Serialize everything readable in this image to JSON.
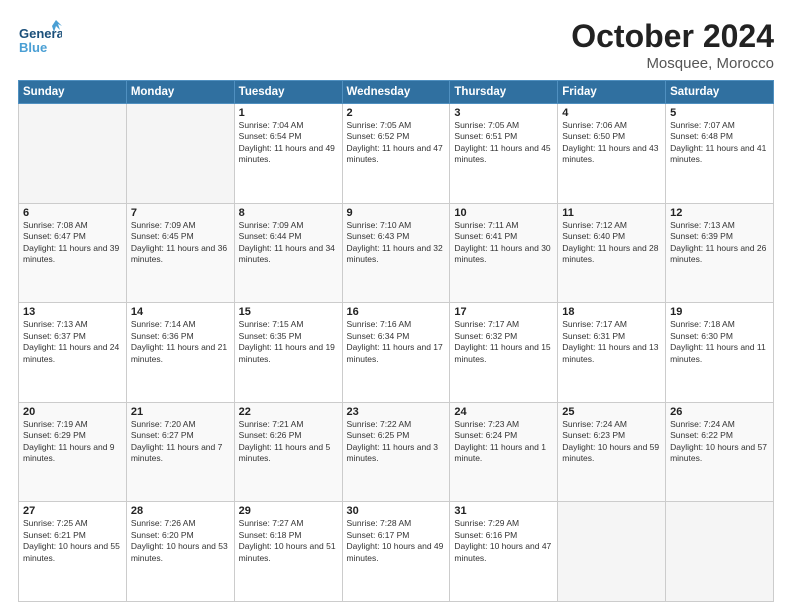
{
  "header": {
    "logo_text_general": "General",
    "logo_text_blue": "Blue",
    "month": "October 2024",
    "location": "Mosquee, Morocco"
  },
  "days_of_week": [
    "Sunday",
    "Monday",
    "Tuesday",
    "Wednesday",
    "Thursday",
    "Friday",
    "Saturday"
  ],
  "weeks": [
    [
      {
        "day": "",
        "sunrise": "",
        "sunset": "",
        "daylight": ""
      },
      {
        "day": "",
        "sunrise": "",
        "sunset": "",
        "daylight": ""
      },
      {
        "day": "1",
        "sunrise": "Sunrise: 7:04 AM",
        "sunset": "Sunset: 6:54 PM",
        "daylight": "Daylight: 11 hours and 49 minutes."
      },
      {
        "day": "2",
        "sunrise": "Sunrise: 7:05 AM",
        "sunset": "Sunset: 6:52 PM",
        "daylight": "Daylight: 11 hours and 47 minutes."
      },
      {
        "day": "3",
        "sunrise": "Sunrise: 7:05 AM",
        "sunset": "Sunset: 6:51 PM",
        "daylight": "Daylight: 11 hours and 45 minutes."
      },
      {
        "day": "4",
        "sunrise": "Sunrise: 7:06 AM",
        "sunset": "Sunset: 6:50 PM",
        "daylight": "Daylight: 11 hours and 43 minutes."
      },
      {
        "day": "5",
        "sunrise": "Sunrise: 7:07 AM",
        "sunset": "Sunset: 6:48 PM",
        "daylight": "Daylight: 11 hours and 41 minutes."
      }
    ],
    [
      {
        "day": "6",
        "sunrise": "Sunrise: 7:08 AM",
        "sunset": "Sunset: 6:47 PM",
        "daylight": "Daylight: 11 hours and 39 minutes."
      },
      {
        "day": "7",
        "sunrise": "Sunrise: 7:09 AM",
        "sunset": "Sunset: 6:45 PM",
        "daylight": "Daylight: 11 hours and 36 minutes."
      },
      {
        "day": "8",
        "sunrise": "Sunrise: 7:09 AM",
        "sunset": "Sunset: 6:44 PM",
        "daylight": "Daylight: 11 hours and 34 minutes."
      },
      {
        "day": "9",
        "sunrise": "Sunrise: 7:10 AM",
        "sunset": "Sunset: 6:43 PM",
        "daylight": "Daylight: 11 hours and 32 minutes."
      },
      {
        "day": "10",
        "sunrise": "Sunrise: 7:11 AM",
        "sunset": "Sunset: 6:41 PM",
        "daylight": "Daylight: 11 hours and 30 minutes."
      },
      {
        "day": "11",
        "sunrise": "Sunrise: 7:12 AM",
        "sunset": "Sunset: 6:40 PM",
        "daylight": "Daylight: 11 hours and 28 minutes."
      },
      {
        "day": "12",
        "sunrise": "Sunrise: 7:13 AM",
        "sunset": "Sunset: 6:39 PM",
        "daylight": "Daylight: 11 hours and 26 minutes."
      }
    ],
    [
      {
        "day": "13",
        "sunrise": "Sunrise: 7:13 AM",
        "sunset": "Sunset: 6:37 PM",
        "daylight": "Daylight: 11 hours and 24 minutes."
      },
      {
        "day": "14",
        "sunrise": "Sunrise: 7:14 AM",
        "sunset": "Sunset: 6:36 PM",
        "daylight": "Daylight: 11 hours and 21 minutes."
      },
      {
        "day": "15",
        "sunrise": "Sunrise: 7:15 AM",
        "sunset": "Sunset: 6:35 PM",
        "daylight": "Daylight: 11 hours and 19 minutes."
      },
      {
        "day": "16",
        "sunrise": "Sunrise: 7:16 AM",
        "sunset": "Sunset: 6:34 PM",
        "daylight": "Daylight: 11 hours and 17 minutes."
      },
      {
        "day": "17",
        "sunrise": "Sunrise: 7:17 AM",
        "sunset": "Sunset: 6:32 PM",
        "daylight": "Daylight: 11 hours and 15 minutes."
      },
      {
        "day": "18",
        "sunrise": "Sunrise: 7:17 AM",
        "sunset": "Sunset: 6:31 PM",
        "daylight": "Daylight: 11 hours and 13 minutes."
      },
      {
        "day": "19",
        "sunrise": "Sunrise: 7:18 AM",
        "sunset": "Sunset: 6:30 PM",
        "daylight": "Daylight: 11 hours and 11 minutes."
      }
    ],
    [
      {
        "day": "20",
        "sunrise": "Sunrise: 7:19 AM",
        "sunset": "Sunset: 6:29 PM",
        "daylight": "Daylight: 11 hours and 9 minutes."
      },
      {
        "day": "21",
        "sunrise": "Sunrise: 7:20 AM",
        "sunset": "Sunset: 6:27 PM",
        "daylight": "Daylight: 11 hours and 7 minutes."
      },
      {
        "day": "22",
        "sunrise": "Sunrise: 7:21 AM",
        "sunset": "Sunset: 6:26 PM",
        "daylight": "Daylight: 11 hours and 5 minutes."
      },
      {
        "day": "23",
        "sunrise": "Sunrise: 7:22 AM",
        "sunset": "Sunset: 6:25 PM",
        "daylight": "Daylight: 11 hours and 3 minutes."
      },
      {
        "day": "24",
        "sunrise": "Sunrise: 7:23 AM",
        "sunset": "Sunset: 6:24 PM",
        "daylight": "Daylight: 11 hours and 1 minute."
      },
      {
        "day": "25",
        "sunrise": "Sunrise: 7:24 AM",
        "sunset": "Sunset: 6:23 PM",
        "daylight": "Daylight: 10 hours and 59 minutes."
      },
      {
        "day": "26",
        "sunrise": "Sunrise: 7:24 AM",
        "sunset": "Sunset: 6:22 PM",
        "daylight": "Daylight: 10 hours and 57 minutes."
      }
    ],
    [
      {
        "day": "27",
        "sunrise": "Sunrise: 7:25 AM",
        "sunset": "Sunset: 6:21 PM",
        "daylight": "Daylight: 10 hours and 55 minutes."
      },
      {
        "day": "28",
        "sunrise": "Sunrise: 7:26 AM",
        "sunset": "Sunset: 6:20 PM",
        "daylight": "Daylight: 10 hours and 53 minutes."
      },
      {
        "day": "29",
        "sunrise": "Sunrise: 7:27 AM",
        "sunset": "Sunset: 6:18 PM",
        "daylight": "Daylight: 10 hours and 51 minutes."
      },
      {
        "day": "30",
        "sunrise": "Sunrise: 7:28 AM",
        "sunset": "Sunset: 6:17 PM",
        "daylight": "Daylight: 10 hours and 49 minutes."
      },
      {
        "day": "31",
        "sunrise": "Sunrise: 7:29 AM",
        "sunset": "Sunset: 6:16 PM",
        "daylight": "Daylight: 10 hours and 47 minutes."
      },
      {
        "day": "",
        "sunrise": "",
        "sunset": "",
        "daylight": ""
      },
      {
        "day": "",
        "sunrise": "",
        "sunset": "",
        "daylight": ""
      }
    ]
  ]
}
